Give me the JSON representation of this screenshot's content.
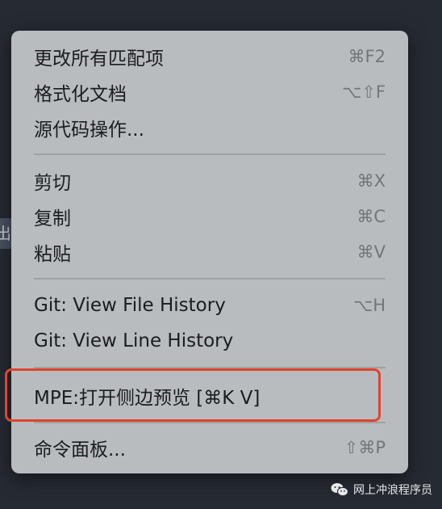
{
  "left_strip": {
    "text": "出"
  },
  "menu": {
    "items": [
      {
        "label": "更改所有匹配项",
        "shortcut": "⌘F2"
      },
      {
        "label": "格式化文档",
        "shortcut": "⌥⇧F"
      },
      {
        "label": "源代码操作...",
        "shortcut": ""
      },
      {
        "label": "剪切",
        "shortcut": "⌘X"
      },
      {
        "label": "复制",
        "shortcut": "⌘C"
      },
      {
        "label": "粘贴",
        "shortcut": "⌘V"
      },
      {
        "label": "Git: View File History",
        "shortcut": "⌥H"
      },
      {
        "label": "Git: View Line History",
        "shortcut": ""
      },
      {
        "label": "MPE:打开侧边预览 [⌘K V]",
        "shortcut": ""
      },
      {
        "label": "命令面板...",
        "shortcut": "⇧⌘P"
      }
    ]
  },
  "annotation": {
    "color": "#e0442d"
  },
  "watermark": {
    "text": "网上冲浪程序员",
    "icon": "wechat-icon"
  }
}
